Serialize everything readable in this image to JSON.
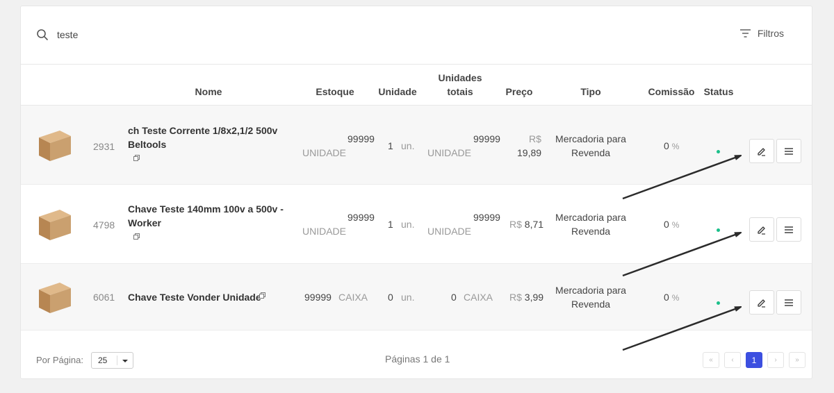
{
  "search": {
    "value": "teste",
    "placeholder": ""
  },
  "filters": {
    "label": "Filtros"
  },
  "columns": {
    "nome": "Nome",
    "estoque": "Estoque",
    "unidade": "Unidade",
    "unidades_totais_1": "Unidades",
    "unidades_totais_2": "totais",
    "preco": "Preço",
    "tipo": "Tipo",
    "comissao": "Comissão",
    "status": "Status"
  },
  "rows": [
    {
      "code": "2931",
      "name_line1": "ch Teste Corrente 1/8x2,1/2 500v",
      "name_line2": "Beltools",
      "estoque": "99999",
      "estoque_unit": "UNIDADE",
      "unidade_qty": "1",
      "unidade_label": "un.",
      "totais": "99999",
      "totais_unit": "UNIDADE",
      "price_currency": "R$",
      "price_value": "19,89",
      "tipo_1": "Mercadoria para",
      "tipo_2": "Revenda",
      "comissao": "0",
      "comissao_unit": "%"
    },
    {
      "code": "4798",
      "name_line1": "Chave Teste 140mm 100v a 500v -",
      "name_line2": "Worker",
      "estoque": "99999",
      "estoque_unit": "UNIDADE",
      "unidade_qty": "1",
      "unidade_label": "un.",
      "totais": "99999",
      "totais_unit": "UNIDADE",
      "price_currency": "R$",
      "price_value": "8,71",
      "tipo_1": "Mercadoria para",
      "tipo_2": "Revenda",
      "comissao": "0",
      "comissao_unit": "%"
    },
    {
      "code": "6061",
      "name_line1": "Chave Teste Vonder Unidade",
      "estoque": "99999",
      "estoque_unit": "CAIXA",
      "unidade_qty": "0",
      "unidade_label": "un.",
      "totais": "0",
      "totais_unit": "CAIXA",
      "price_currency": "R$",
      "price_value": "3,99",
      "tipo_1": "Mercadoria para",
      "tipo_2": "Revenda",
      "comissao": "0",
      "comissao_unit": "%"
    }
  ],
  "footer": {
    "per_page_label": "Por Página:",
    "per_page_value": "25",
    "pages_label": "Páginas 1 de 1",
    "first": "«",
    "prev": "‹",
    "current": "1",
    "next": "›",
    "last": "»"
  },
  "colors": {
    "accent": "#3c4fe0",
    "status_active": "#1bbf8a"
  },
  "icons": [
    "search-icon",
    "filter-icon",
    "box-icon",
    "copy-icon",
    "edit-icon",
    "menu-icon",
    "arrow-annotation"
  ]
}
